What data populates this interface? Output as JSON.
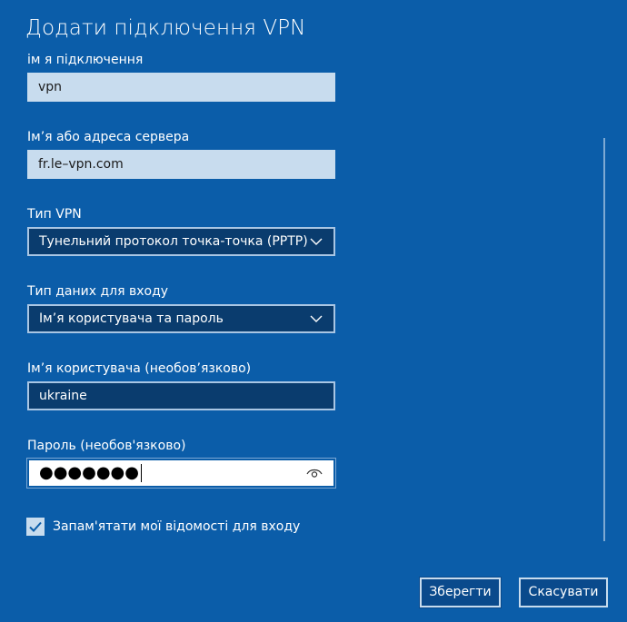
{
  "dialog": {
    "title": "Додати підключення VPN"
  },
  "fields": {
    "connection_name": {
      "label": "ім я підключення",
      "value": "vpn"
    },
    "server": {
      "label": "Ім’я або адреса сервера",
      "value": "fr.le–vpn.com"
    },
    "vpn_type": {
      "label": "Тип VPN",
      "value": "Тунельний протокол точка-точка (PPTP)"
    },
    "signin_type": {
      "label": "Тип даних для входу",
      "value": "Ім’я користувача та пароль"
    },
    "username": {
      "label": "Ім’я користувача (необов’язково)",
      "value": "ukraine"
    },
    "password": {
      "label": "Пароль (необов'язково)",
      "value": "●●●●●●●"
    }
  },
  "remember": {
    "label": "Запам'ятати мої відомості для входу",
    "checked": true
  },
  "buttons": {
    "save": "Зберегти",
    "cancel": "Скасувати"
  },
  "colors": {
    "background": "#0b5da9",
    "disabled_field": "#c8dcee",
    "dark_field": "#0a3c6e",
    "button_fill": "#0a4a8c"
  }
}
